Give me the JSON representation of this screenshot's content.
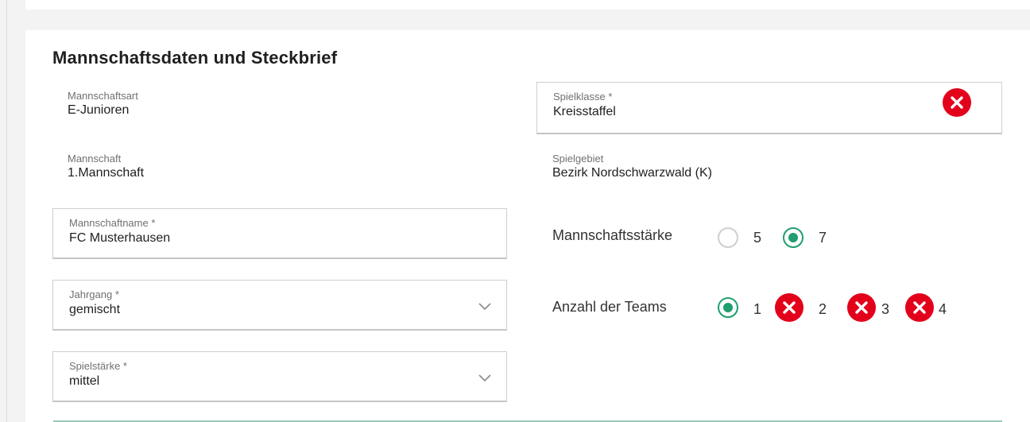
{
  "section": {
    "title": "Mannschaftsdaten und Steckbrief"
  },
  "mannschaftsart": {
    "label": "Mannschaftsart",
    "value": "E-Junioren"
  },
  "mannschaft": {
    "label": "Mannschaft",
    "value": "1.Mannschaft"
  },
  "mannschaftname": {
    "label": "Mannschaftname *",
    "value": "FC Musterhausen"
  },
  "jahrgang": {
    "label": "Jahrgang *",
    "value": "gemischt"
  },
  "spielstaerke": {
    "label": "Spielstärke *",
    "value": "mittel"
  },
  "spielklasse": {
    "label": "Spielklasse *",
    "value": "Kreisstaffel"
  },
  "spielgebiet": {
    "label": "Spielgebiet",
    "value": "Bezirk Nordschwarzwald (K)"
  },
  "mannschaftsstaerke": {
    "label": "Mannschaftsstärke",
    "options": [
      {
        "label": "5",
        "selected": false
      },
      {
        "label": "7",
        "selected": true
      }
    ]
  },
  "anzahl_teams": {
    "label": "Anzahl der Teams",
    "options": [
      {
        "label": "1",
        "selected": true,
        "error": false
      },
      {
        "label": "2",
        "selected": false,
        "error": true
      },
      {
        "label": "3",
        "selected": false,
        "error": true
      },
      {
        "label": "4",
        "selected": false,
        "error": true
      }
    ]
  },
  "icons": {
    "error": "x-circle-icon",
    "dropdown": "chevron-down-icon"
  },
  "colors": {
    "accent": "#1f9e6e",
    "error": "#e3001b",
    "border": "#cfcfcf"
  }
}
